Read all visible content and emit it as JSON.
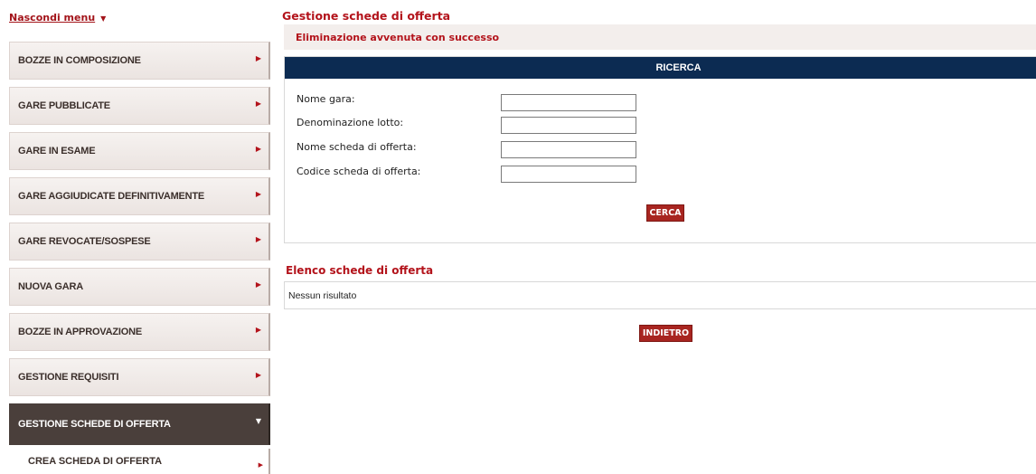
{
  "sidebar": {
    "hide_menu_label": "Nascondi menu",
    "items": [
      {
        "label": "BOZZE IN COMPOSIZIONE"
      },
      {
        "label": "GARE PUBBLICATE"
      },
      {
        "label": "GARE IN ESAME"
      },
      {
        "label": "GARE AGGIUDICATE DEFINITIVAMENTE"
      },
      {
        "label": "GARE REVOCATE/SOSPESE"
      },
      {
        "label": "NUOVA GARA"
      },
      {
        "label": "BOZZE IN APPROVAZIONE"
      },
      {
        "label": "GESTIONE REQUISITI"
      },
      {
        "label": "GESTIONE SCHEDE DI OFFERTA",
        "active": true
      }
    ],
    "subitems": [
      {
        "label": "CREA SCHEDA DI OFFERTA"
      }
    ]
  },
  "main": {
    "title": "Gestione schede di offerta",
    "success_message": "Eliminazione avvenuta con successo",
    "search": {
      "header": "RICERCA",
      "fields": [
        {
          "label": "Nome gara:",
          "value": ""
        },
        {
          "label": "Denominazione lotto:",
          "value": ""
        },
        {
          "label": "Nome scheda di offerta:",
          "value": ""
        },
        {
          "label": "Codice scheda di offerta:",
          "value": ""
        }
      ],
      "button": "CERCA"
    },
    "list": {
      "title": "Elenco schede di offerta",
      "empty_text": "Nessun risultato"
    },
    "back_button": "INDIETRO"
  },
  "colors": {
    "accent": "#b3131b",
    "header_navy": "#0c2b52",
    "active_menu": "#4a3f3b",
    "button": "#a82520"
  }
}
